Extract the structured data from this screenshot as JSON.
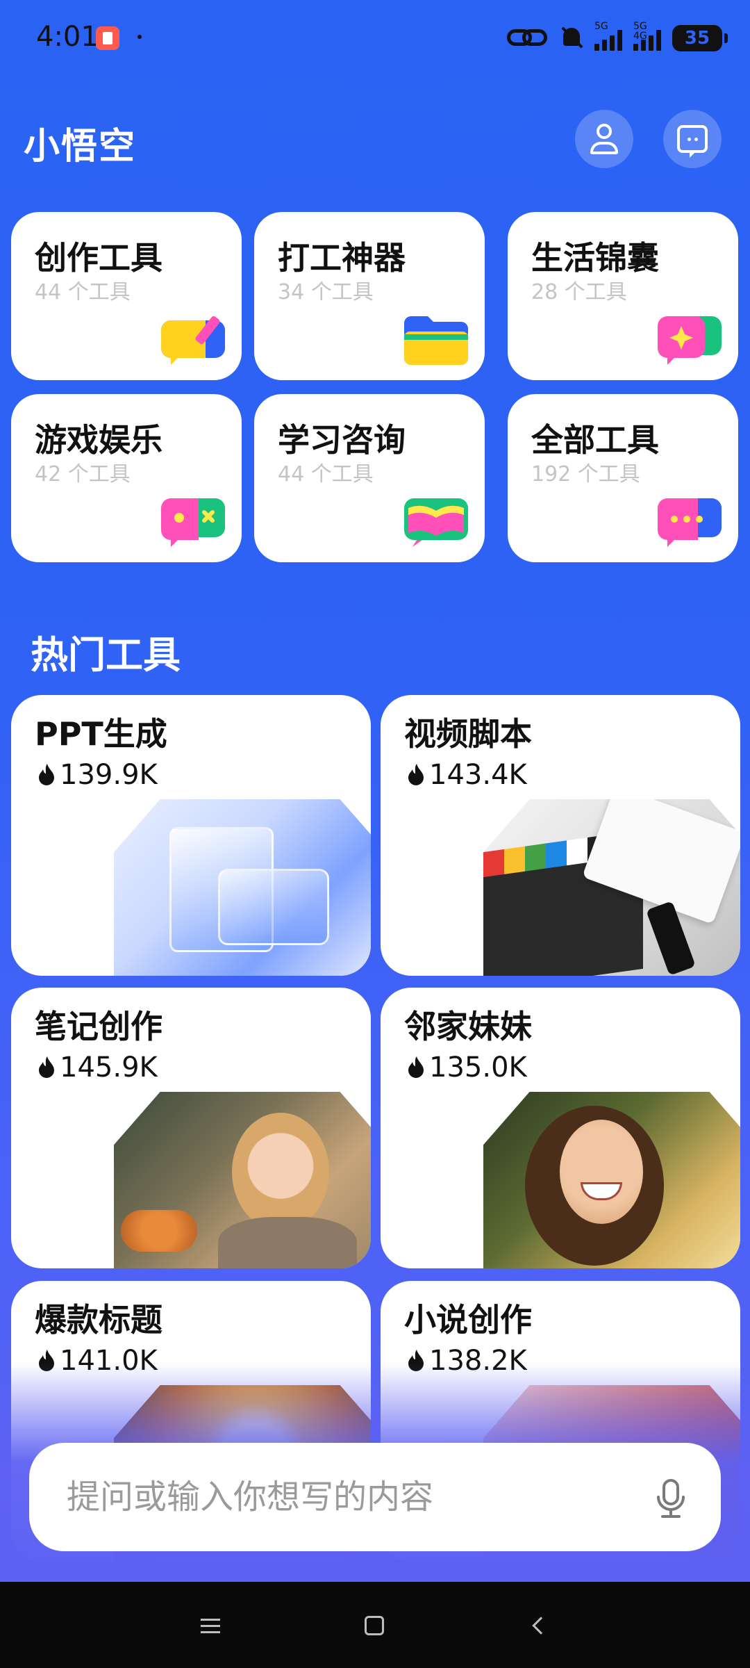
{
  "status_bar": {
    "time": "4:01",
    "network_1": "5G",
    "network_2": "5G 4G",
    "battery": "35"
  },
  "header": {
    "title": "小悟空"
  },
  "categories": [
    {
      "title": "创作工具",
      "count": "44 个工具",
      "icon": "edit-bubble-icon"
    },
    {
      "title": "打工神器",
      "count": "34 个工具",
      "icon": "folder-icon"
    },
    {
      "title": "生活锦囊",
      "count": "28 个工具",
      "icon": "sparkle-bubble-icon"
    },
    {
      "title": "游戏娱乐",
      "count": "42 个工具",
      "icon": "game-bubble-icon"
    },
    {
      "title": "学习咨询",
      "count": "44 个工具",
      "icon": "book-icon"
    },
    {
      "title": "全部工具",
      "count": "192 个工具",
      "icon": "more-bubble-icon"
    }
  ],
  "section": {
    "title": "热门工具"
  },
  "hot_tools": [
    {
      "title": "PPT生成",
      "stat": "139.9K"
    },
    {
      "title": "视频脚本",
      "stat": "143.4K"
    },
    {
      "title": "笔记创作",
      "stat": "145.9K"
    },
    {
      "title": "邻家妹妹",
      "stat": "135.0K"
    },
    {
      "title": "爆款标题",
      "stat": "141.0K"
    },
    {
      "title": "小说创作",
      "stat": "138.2K"
    }
  ],
  "input": {
    "placeholder": "提问或输入你想写的内容"
  },
  "colors": {
    "background": "#2f62f5",
    "card": "#ffffff",
    "muted_text": "#c4c4c4"
  }
}
